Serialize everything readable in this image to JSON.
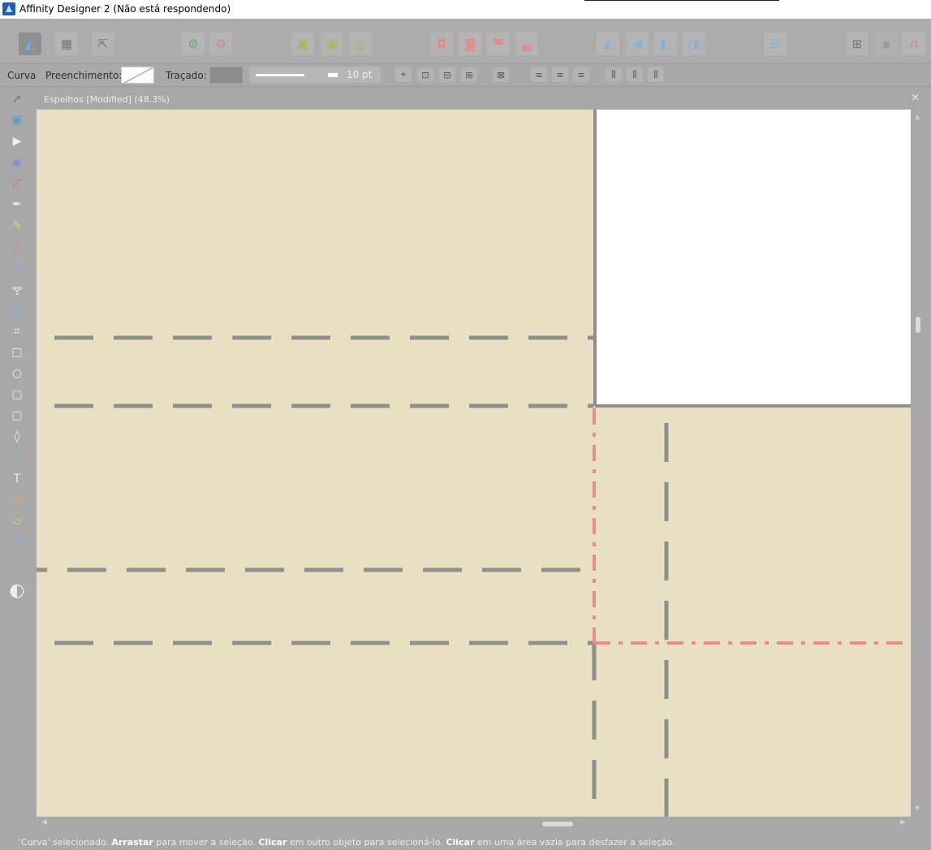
{
  "window": {
    "title": "Affinity Designer 2 (Não está respondendo)"
  },
  "toolbar": {
    "icons": [
      "designer-persona-icon",
      "pixel-persona-icon",
      "export-persona-icon",
      "settings-gear-icon",
      "snapping-gear-icon",
      "insert-inside-icon",
      "insert-behind-icon",
      "insert-front-icon",
      "boolean-add-icon",
      "boolean-subtract-icon",
      "boolean-intersect-icon",
      "boolean-xor-icon",
      "flip-horizontal-icon",
      "flip-vertical-icon",
      "rotate-left-icon",
      "rotate-right-icon",
      "align-icon",
      "arrange-icon",
      "snapping-magnet-icon"
    ]
  },
  "context_bar": {
    "tool_label": "Curva",
    "fill_label": "Preenchimento:",
    "stroke_label": "Traçado:",
    "stroke_width": "10 pt",
    "stroke_color": "#8c8c8c"
  },
  "document": {
    "tab_title": "Espelhos [Modified] (48.3%)",
    "close_glyph": "×",
    "canvas_color": "#e9dfc3",
    "page_color": "#ffffff",
    "line_color": "#8f8f8f",
    "selection_color": "#f08a8a"
  },
  "tools": [
    "move-tool-icon",
    "artboard-tool-icon",
    "node-tool-icon",
    "contour-tool-icon",
    "corner-tool-icon",
    "pen-tool-icon",
    "pencil-tool-icon",
    "vector-brush-tool-icon",
    "paint-brush-tool-icon",
    "fill-tool-icon",
    "place-image-tool-icon",
    "crop-tool-icon",
    "rectangle-tool-icon",
    "ellipse-tool-icon",
    "rounded-rectangle-tool-icon",
    "shape-tool-icon",
    "transparency-tool-icon",
    "vector-crop-tool-icon",
    "text-tool-icon",
    "color-picker-tool-icon",
    "measure-tool-icon",
    "zoom-tool-icon"
  ],
  "status": {
    "part1": "'Curva' selecionado. ",
    "bold1": "Arrastar",
    "part2": " para mover a seleção. ",
    "bold2": "Clicar",
    "part3": " em outro objeto para selecioná-lo. ",
    "bold3": "Clicar",
    "part4": " em uma área vazia para desfazer a seleção."
  }
}
